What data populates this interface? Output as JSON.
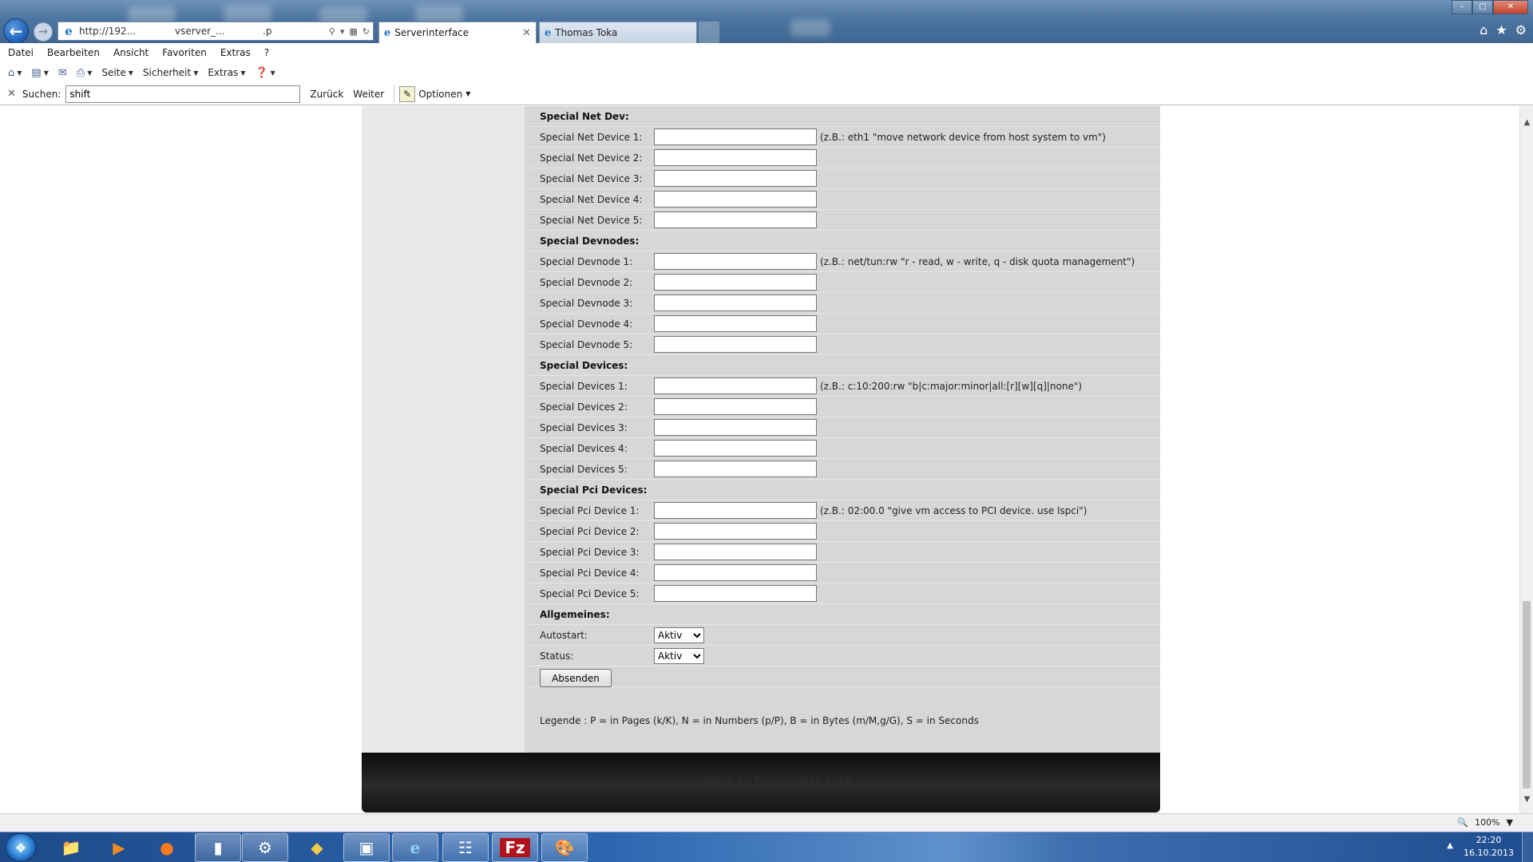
{
  "browser": {
    "address": {
      "url_part1": "http://192...",
      "url_part2": "vserver_...",
      "url_part3": ".p"
    },
    "tabs": [
      {
        "label": "Serverinterface",
        "active": true
      },
      {
        "label": "Thomas Toka",
        "active": false
      }
    ],
    "menu": [
      "Datei",
      "Bearbeiten",
      "Ansicht",
      "Favoriten",
      "Extras",
      "?"
    ],
    "command_bar": {
      "seite": "Seite",
      "sicherheit": "Sicherheit",
      "extras": "Extras"
    },
    "find_bar": {
      "label": "Suchen:",
      "value": "shift",
      "back": "Zurück",
      "next": "Weiter",
      "options": "Optionen"
    }
  },
  "form": {
    "rows": [
      {
        "type": "section",
        "label": "Special Net Dev:"
      },
      {
        "type": "input",
        "label": "Special Net Device 1:",
        "value": "",
        "hint": "(z.B.: eth1 \"move network device from host system to vm\")"
      },
      {
        "type": "input",
        "label": "Special Net Device 2:",
        "value": "",
        "hint": ""
      },
      {
        "type": "input",
        "label": "Special Net Device 3:",
        "value": "",
        "hint": ""
      },
      {
        "type": "input",
        "label": "Special Net Device 4:",
        "value": "",
        "hint": ""
      },
      {
        "type": "input",
        "label": "Special Net Device 5:",
        "value": "",
        "hint": ""
      },
      {
        "type": "section",
        "label": "Special Devnodes:"
      },
      {
        "type": "input",
        "label": "Special Devnode 1:",
        "value": "",
        "hint": "(z.B.: net/tun:rw \"r - read, w - write, q - disk quota management\")"
      },
      {
        "type": "input",
        "label": "Special Devnode 2:",
        "value": "",
        "hint": ""
      },
      {
        "type": "input",
        "label": "Special Devnode 3:",
        "value": "",
        "hint": ""
      },
      {
        "type": "input",
        "label": "Special Devnode 4:",
        "value": "",
        "hint": ""
      },
      {
        "type": "input",
        "label": "Special Devnode 5:",
        "value": "",
        "hint": ""
      },
      {
        "type": "section",
        "label": "Special Devices:"
      },
      {
        "type": "input",
        "label": "Special Devices 1:",
        "value": "",
        "hint": "(z.B.: c:10:200:rw \"b|c:major:minor|all:[r][w][q]|none\")"
      },
      {
        "type": "input",
        "label": "Special Devices 2:",
        "value": "",
        "hint": ""
      },
      {
        "type": "input",
        "label": "Special Devices 3:",
        "value": "",
        "hint": ""
      },
      {
        "type": "input",
        "label": "Special Devices 4:",
        "value": "",
        "hint": ""
      },
      {
        "type": "input",
        "label": "Special Devices 5:",
        "value": "",
        "hint": ""
      },
      {
        "type": "section",
        "label": "Special Pci Devices:"
      },
      {
        "type": "input",
        "label": "Special Pci Device 1:",
        "value": "",
        "hint": "(z.B.: 02:00.0 \"give vm access to PCI device. use lspci\")"
      },
      {
        "type": "input",
        "label": "Special Pci Device 2:",
        "value": "",
        "hint": ""
      },
      {
        "type": "input",
        "label": "Special Pci Device 3:",
        "value": "",
        "hint": ""
      },
      {
        "type": "input",
        "label": "Special Pci Device 4:",
        "value": "",
        "hint": ""
      },
      {
        "type": "input",
        "label": "Special Pci Device 5:",
        "value": "",
        "hint": ""
      },
      {
        "type": "section",
        "label": "Allgemeines:"
      },
      {
        "type": "select",
        "label": "Autostart:",
        "value": "Aktiv"
      },
      {
        "type": "select",
        "label": "Status:",
        "value": "Aktiv"
      }
    ],
    "submit_label": "Absenden",
    "legend": "Legende : P = in Pages (k/K), N = in Numbers (p/P), B = in Bytes (m/M,g/G), S = in Seconds"
  },
  "footer": {
    "copyright": "Copyright © by Thomas Toka 2010"
  },
  "status_bar": {
    "zoom": "100%"
  },
  "taskbar": {
    "time": "22:20",
    "date": "16.10.2013"
  }
}
